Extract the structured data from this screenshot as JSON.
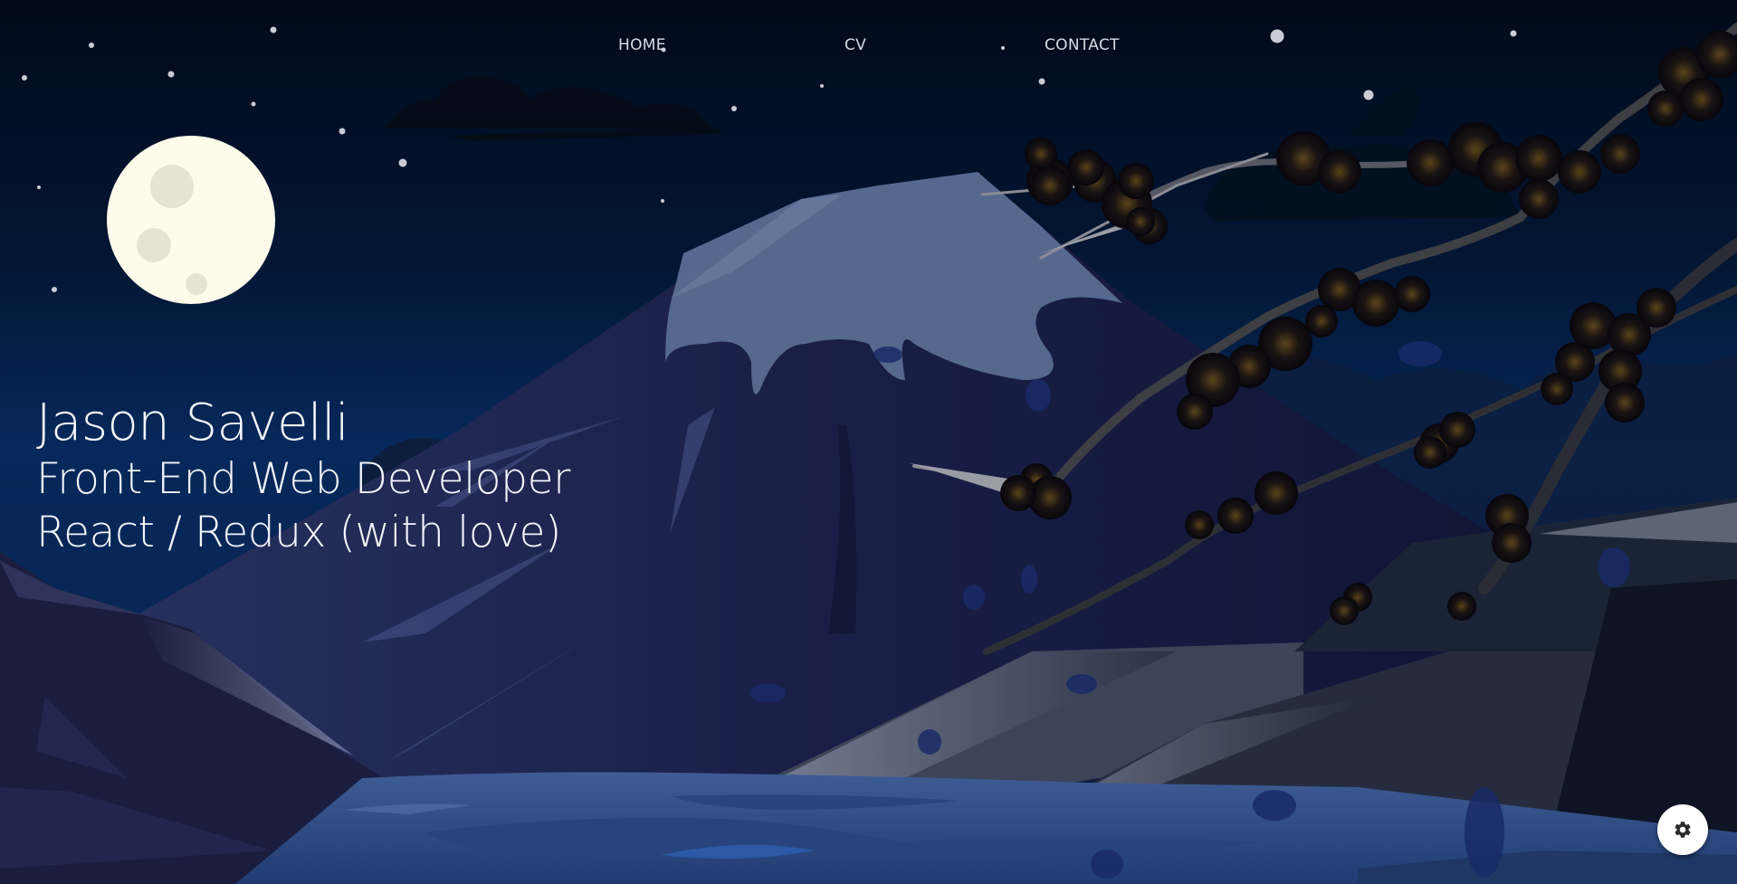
{
  "nav": {
    "items": [
      {
        "label": "HOME"
      },
      {
        "label": "CV"
      },
      {
        "label": "CONTACT"
      }
    ]
  },
  "hero": {
    "name": "Jason Savelli",
    "title": "Front-End Web Developer",
    "tagline": "React / Redux (with love)"
  },
  "settings": {
    "icon": "gear-icon"
  },
  "colors": {
    "sky_top": "#020b1e",
    "sky_bottom": "#062a5a",
    "moon": "#fdfbea",
    "mountain": "#12183a",
    "snow": "#56688e",
    "water": "#2a4a80",
    "blossom": "#0d0a10"
  }
}
